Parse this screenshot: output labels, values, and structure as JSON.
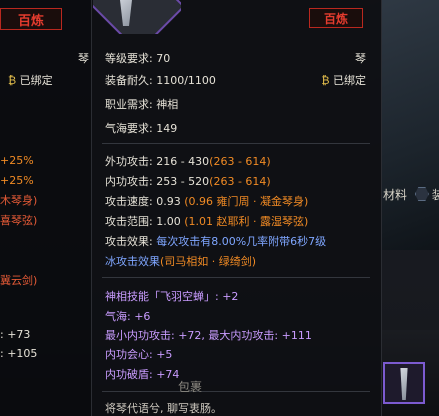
{
  "left_panel": {
    "tier": "百炼",
    "lines": [
      {
        "text": "琴",
        "top": 0
      },
      {
        "text": "已绑定"
      },
      {
        "text": "+25%"
      },
      {
        "text": "+25%"
      },
      {
        "text": "木琴身)"
      },
      {
        "text": "喜琴弦)"
      },
      {
        "text": "冀云剑)"
      },
      {
        "text": ": +73"
      },
      {
        "text": ": +105"
      }
    ]
  },
  "tooltip": {
    "tier": "百炼",
    "item_type": "琴",
    "bound_label": "已绑定",
    "level_req": "等级要求: 70",
    "durability": "装备耐久: 1100/1100",
    "class_req": "职业需求: 神相",
    "qihai_req": "气海要求: 149",
    "outer_attack_label": "外功攻击: 216 - 430",
    "outer_attack_range": "(263 - 614)",
    "inner_attack_label": "内功攻击: 253 - 520",
    "inner_attack_range": "(263 - 614)",
    "speed_label": "攻击速度: 0.93",
    "speed_bonus": "(0.96 雍门周 · 凝金琴身)",
    "range_label": "攻击范围: 1.00",
    "range_bonus": "(1.01 赵耶利 · 露湿琴弦)",
    "effect_label": "攻击效果:",
    "effect_text_1": "每次攻击有8.00%几率附带6秒7级",
    "effect_text_2": "冰攻击效果",
    "effect_source": "(司马相如 · 绿绮剑)",
    "skill_line": "神相技能「飞羽空蝉」: +2",
    "qihai_line": "气海: +6",
    "min_inner_line": "最小内功攻击: +72, 最大内功攻击: +111",
    "inner_crit_line": "内功会心: +5",
    "inner_pierce_line": "内功破盾: +74",
    "flavor_text": "将琴代语兮, 聊写衷肠。"
  },
  "right_side": {
    "tab_material": "材料",
    "tab_equip": "装备",
    "bag_label": "包裹"
  }
}
